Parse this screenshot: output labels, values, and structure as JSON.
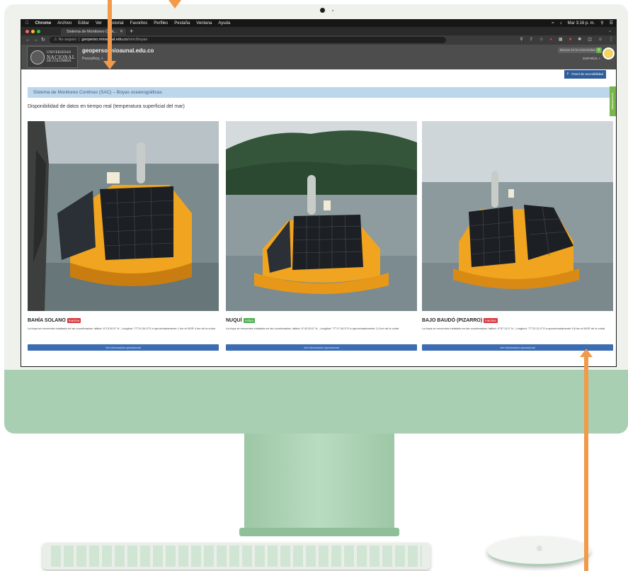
{
  "menubar": {
    "apple": "",
    "app": "Chrome",
    "items": [
      "Archivo",
      "Editar",
      "Ver",
      "Historial",
      "Favoritos",
      "Perfiles",
      "Pestaña",
      "Ventana",
      "Ayuda"
    ],
    "clock": "Mar 3:16 p. m."
  },
  "browser": {
    "tab_title": "Sistema de Monitoreo Cont...",
    "newtab": "+",
    "security": "No seguro",
    "url_host": "geoperso.mioaunal.edu.co",
    "url_path": "/smc/boyas"
  },
  "site": {
    "logo_line1": "UNIVERSIDAD",
    "logo_line2": "NACIONAL",
    "logo_line3": "DE COLOMBIA",
    "domain": "geoperso.mioaunal.edu.co",
    "nav": "Pesca/Acq. +",
    "search_placeholder": "Buscar en la Universidad",
    "lang": "ESPAÑOL +",
    "accessibility": "Panel de accesibilidad",
    "side_tab": "Accesibilidad"
  },
  "page": {
    "band": "Sistema de Monitoreo Continuo (SAC) – Boyas oceanográficas",
    "subtitle": "Disponibilidad de datos en tiempo real (temperatura superficial del mar)"
  },
  "cards": [
    {
      "title": "BAHÍA SOLANO",
      "status": "Inactiva",
      "status_color": "#d9363e",
      "desc": "La boya se encuentra instalada en las coordenadas: latitud: 6°13.00.0\" N , Longitud: 77°24.34.0\"O a aproximadamente 1 km al NOR 4 km de la costa",
      "button": "Ver información operacional"
    },
    {
      "title": "NUQUÍ",
      "status": "Activa",
      "status_color": "#4caf50",
      "desc": "La boya se encuentra instalada en las coordenadas: latitud: 5°42.53.0\" N , Longitud: 77°17.04.0\"O a aproximadamente 2,4 km de la costa",
      "button": "Ver información operacional"
    },
    {
      "title": "BAJO BAUDÓ (PIZARRO)",
      "status": "Inactiva",
      "status_color": "#d9363e",
      "desc": "La boya se encuentra instalada en las coordenadas: latitud: 4°57.11.0\" N , Longitud: 77°22.21.0\"O a aproximadamente 5,6 km al NOR de la costa",
      "button": "Ver información operacional"
    }
  ]
}
